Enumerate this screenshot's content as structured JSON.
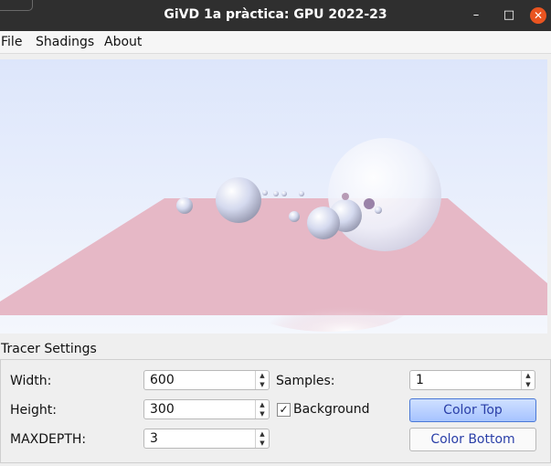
{
  "window": {
    "title": "GiVD 1a pràctica: GPU 2022-23"
  },
  "window_controls": {
    "minimize": "–",
    "maximize": "□",
    "close": "✕"
  },
  "menu": {
    "items": [
      "File",
      "Shadings",
      "About"
    ]
  },
  "viewport": {
    "floor_color": "#e8b9c7",
    "sky_color": "#e6ecfb",
    "spheres": [
      {
        "kind": "small"
      },
      {
        "kind": "medium"
      },
      {
        "kind": "large"
      }
    ]
  },
  "tracer": {
    "section_title": "Tracer Settings",
    "width_label": "Width:",
    "width_value": "600",
    "height_label": "Height:",
    "height_value": "300",
    "maxdepth_label": "MAXDEPTH:",
    "maxdepth_value": "3",
    "samples_label": "Samples:",
    "samples_value": "1",
    "background_label": "Background",
    "background_checked": true,
    "color_top_label": "Color Top",
    "color_bottom_label": "Color Bottom"
  },
  "colors": {
    "accent": "#4a78d6",
    "titlebar": "#2f2f2f",
    "close": "#e95420"
  }
}
